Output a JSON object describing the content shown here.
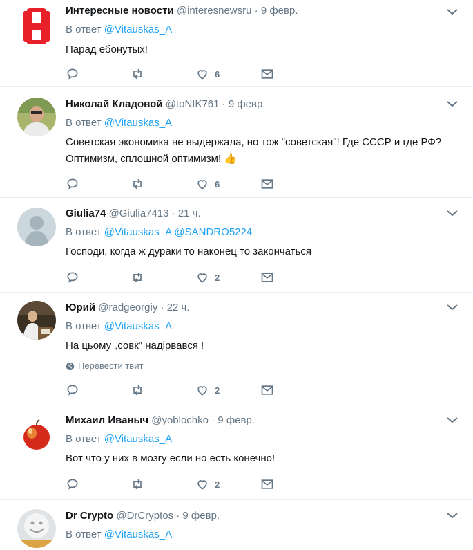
{
  "colors": {
    "link": "#1da1f2",
    "secondary": "#657786",
    "divider": "#e6ecf0"
  },
  "reply_prefix": "В ответ",
  "tweets": [
    {
      "name": "Интересные новости",
      "handle": "@interesnewsru",
      "time": "9 февр.",
      "mentions": "@Vitauskas_A",
      "text_lines": [
        "Парад ебонутых!"
      ],
      "likes": "6",
      "avatar": "logo-H"
    },
    {
      "name": "Николай Кладовой",
      "handle": "@toNIK761",
      "time": "9 февр.",
      "mentions": "@Vitauskas_A",
      "text_lines": [
        "Советская экономика не выдержала, но тож \"советская\"! Где СССР и где РФ?",
        "Оптимизм, сплошной оптимизм!"
      ],
      "emoji": "👍",
      "likes": "6",
      "avatar": "photo-man"
    },
    {
      "name": "Giulia74",
      "handle": "@Giulia7413",
      "time": "21 ч.",
      "mentions": "@Vitauskas_A @SANDRO5224",
      "text_lines": [
        "Господи, когда ж дураки то наконец то закончаться"
      ],
      "likes": "2",
      "avatar": "default-avatar"
    },
    {
      "name": "Юрий",
      "handle": "@radgeorgiy",
      "time": "22 ч.",
      "mentions": "@Vitauskas_A",
      "text_lines": [
        "На цьому „совк\" надірвався !"
      ],
      "translate": "Перевести твит",
      "likes": "2",
      "avatar": "photo-desk"
    },
    {
      "name": "Михаил Иваныч",
      "handle": "@yoblochko",
      "time": "9 февр.",
      "mentions": "@Vitauskas_A",
      "text_lines": [
        "Вот что у них в мозгу если но есть конечно!"
      ],
      "likes": "2",
      "avatar": "apple"
    },
    {
      "name": "Dr Crypto",
      "handle": "@DrCryptos",
      "time": "9 февр.",
      "mentions": "@Vitauskas_A",
      "text_lines": [],
      "avatar": "smiley"
    }
  ]
}
